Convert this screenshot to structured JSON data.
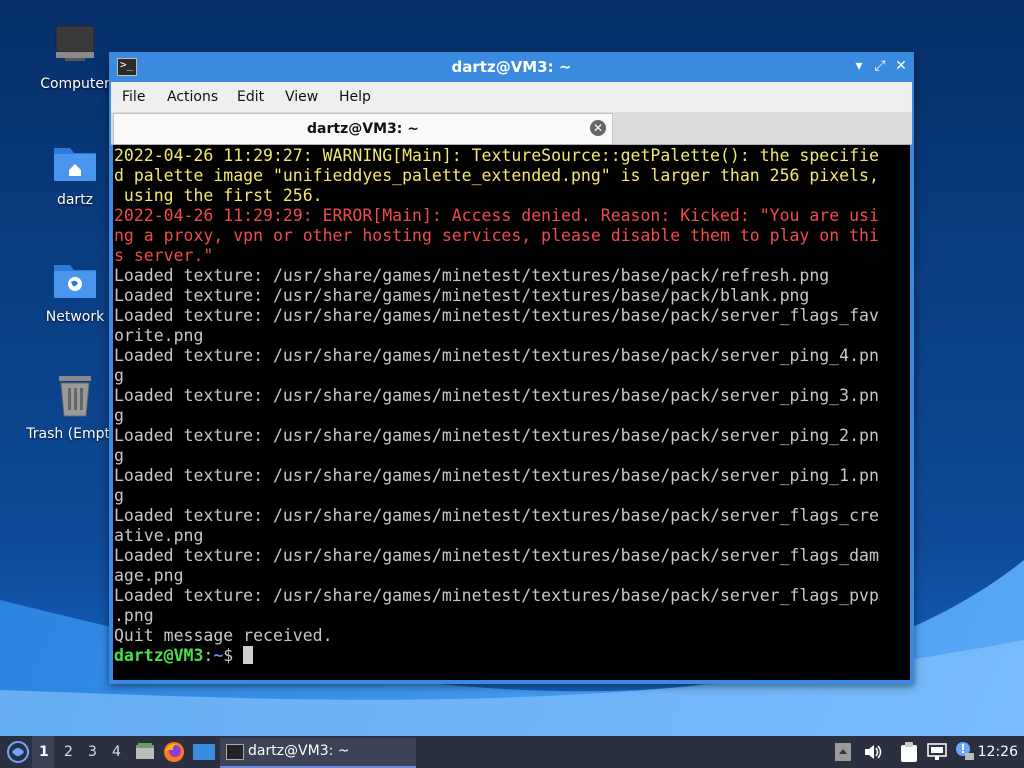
{
  "desktop": {
    "icons": [
      {
        "label": "Computer",
        "icon": "computer-icon"
      },
      {
        "label": "dartz",
        "icon": "home-folder-icon"
      },
      {
        "label": "Network",
        "icon": "network-folder-icon"
      },
      {
        "label": "Trash (Empty)",
        "icon": "trash-icon"
      }
    ]
  },
  "window": {
    "title": "dartz@VM3: ~",
    "menu": [
      "File",
      "Actions",
      "Edit",
      "View",
      "Help"
    ],
    "tab_label": "dartz@VM3: ~",
    "buttons": {
      "minimize": "▾",
      "restore": "⤢",
      "close": "✕"
    }
  },
  "terminal": {
    "lines": [
      {
        "text": "2022-04-26 11:29:27: WARNING[Main]: TextureSource::getPalette(): the specifie",
        "kind": "warn"
      },
      {
        "text": "d palette image \"unifieddyes_palette_extended.png\" is larger than 256 pixels,",
        "kind": "warn"
      },
      {
        "text": " using the first 256.",
        "kind": "warn"
      },
      {
        "text": "2022-04-26 11:29:29: ERROR[Main]: Access denied. Reason: Kicked: \"You are usi",
        "kind": "err"
      },
      {
        "text": "ng a proxy, vpn or other hosting services, please disable them to play on thi",
        "kind": "err"
      },
      {
        "text": "s server.\"",
        "kind": "err"
      },
      {
        "text": "Loaded texture: /usr/share/games/minetest/textures/base/pack/refresh.png",
        "kind": "norm"
      },
      {
        "text": "Loaded texture: /usr/share/games/minetest/textures/base/pack/blank.png",
        "kind": "norm"
      },
      {
        "text": "Loaded texture: /usr/share/games/minetest/textures/base/pack/server_flags_fav",
        "kind": "norm"
      },
      {
        "text": "orite.png",
        "kind": "norm"
      },
      {
        "text": "Loaded texture: /usr/share/games/minetest/textures/base/pack/server_ping_4.pn",
        "kind": "norm"
      },
      {
        "text": "g",
        "kind": "norm"
      },
      {
        "text": "Loaded texture: /usr/share/games/minetest/textures/base/pack/server_ping_3.pn",
        "kind": "norm"
      },
      {
        "text": "g",
        "kind": "norm"
      },
      {
        "text": "Loaded texture: /usr/share/games/minetest/textures/base/pack/server_ping_2.pn",
        "kind": "norm"
      },
      {
        "text": "g",
        "kind": "norm"
      },
      {
        "text": "Loaded texture: /usr/share/games/minetest/textures/base/pack/server_ping_1.pn",
        "kind": "norm"
      },
      {
        "text": "g",
        "kind": "norm"
      },
      {
        "text": "Loaded texture: /usr/share/games/minetest/textures/base/pack/server_flags_cre",
        "kind": "norm"
      },
      {
        "text": "ative.png",
        "kind": "norm"
      },
      {
        "text": "Loaded texture: /usr/share/games/minetest/textures/base/pack/server_flags_dam",
        "kind": "norm"
      },
      {
        "text": "age.png",
        "kind": "norm"
      },
      {
        "text": "Loaded texture: /usr/share/games/minetest/textures/base/pack/server_flags_pvp",
        "kind": "norm"
      },
      {
        "text": ".png",
        "kind": "norm"
      },
      {
        "text": "Quit message received.",
        "kind": "norm"
      }
    ],
    "prompt": {
      "user": "dartz@VM3",
      "sep": ":",
      "path": "~",
      "symbol": "$ "
    }
  },
  "taskbar": {
    "workspaces": [
      "1",
      "2",
      "3",
      "4"
    ],
    "active_workspace": "1",
    "launchers": [
      "file-manager-icon",
      "firefox-icon",
      "show-desktop-icon"
    ],
    "task_label": "dartz@VM3: ~",
    "tray": [
      "scroll-up-icon",
      "volume-icon",
      "clipboard-icon",
      "network-icon",
      "update-notifier-icon"
    ],
    "clock": "12:26"
  },
  "colors": {
    "titlebar": "#3a8be0",
    "warning": "#f3e96b",
    "error": "#ef4b4b",
    "normal": "#c8c8c8",
    "prompt_user": "#4be04b",
    "prompt_path": "#5b8cf0"
  }
}
